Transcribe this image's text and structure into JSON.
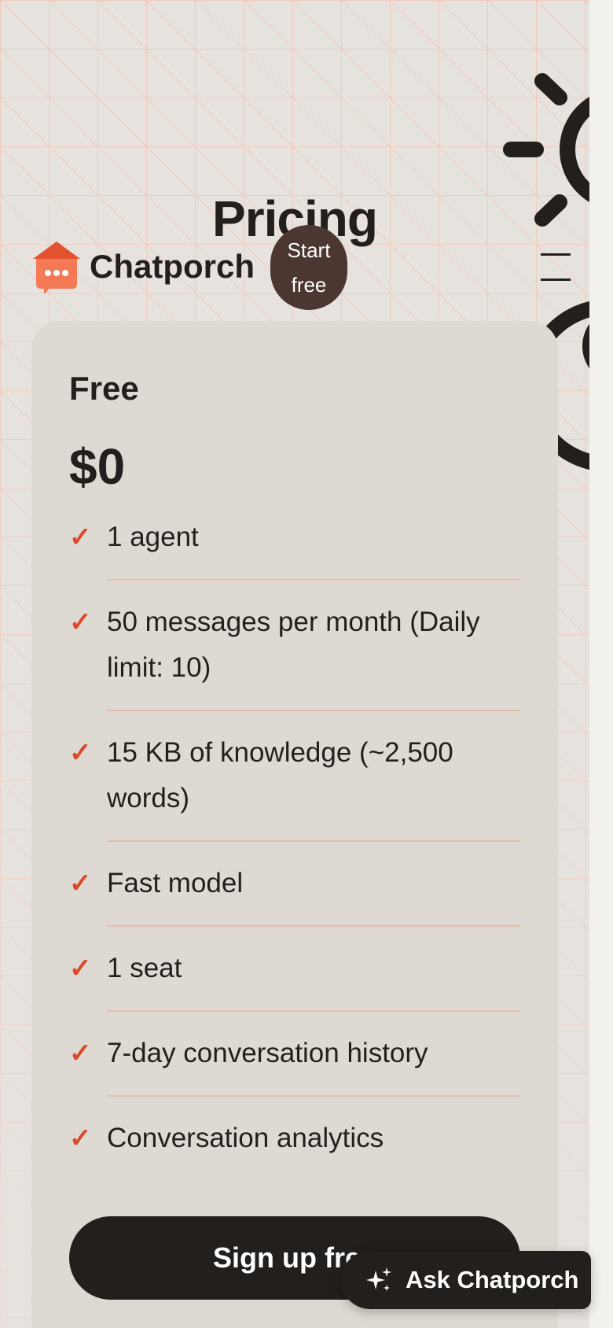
{
  "page": {
    "title": "Pricing"
  },
  "header": {
    "brand_name": "Chatporch",
    "cta_label": "Start free",
    "menu_icon": "hamburger-menu-icon"
  },
  "plan": {
    "name": "Free",
    "price": "$0",
    "features": [
      "1 agent",
      "50 messages per month (Daily limit: 10)",
      "15 KB of knowledge (~2,500 words)",
      "Fast model",
      "1 seat",
      "7-day conversation history",
      "Conversation analytics"
    ],
    "cta_label": "Sign up free"
  },
  "assistant": {
    "label": "Ask Chatporch",
    "icon": "sparkle-icon"
  },
  "colors": {
    "accent": "#d94a2a",
    "dark": "#231f1c",
    "start_button": "#4b3631",
    "card": "#dedad3",
    "background": "#e6e3de",
    "grid_lines": "#f0c4b8"
  }
}
